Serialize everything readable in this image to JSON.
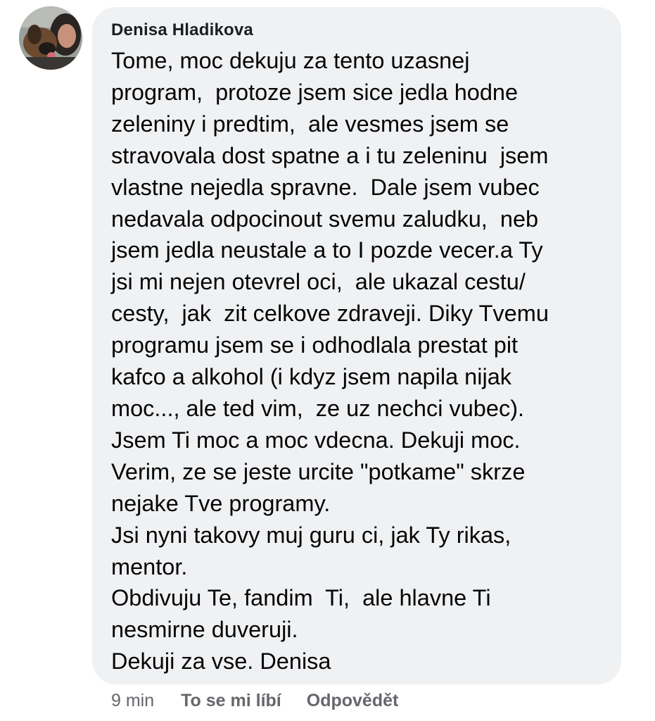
{
  "comment": {
    "author": "Denisa Hladikova",
    "lines": [
      "Tome, moc dekuju za tento uzasnej",
      "program,  protoze jsem sice jedla hodne",
      "zeleniny i predtim,  ale vesmes jsem se",
      "stravovala dost spatne a i tu zeleninu  jsem",
      "vlastne nejedla spravne.  Dale jsem vubec",
      "nedavala odpocinout svemu zaludku,  neb",
      "jsem jedla neustale a to I pozde vecer.a Ty",
      "jsi mi nejen otevrel oci,  ale ukazal cestu/",
      "cesty,  jak  zit celkove zdraveji. Diky Tvemu",
      "programu jsem se i odhodlala prestat pit",
      "kafco a alkohol (i kdyz jsem napila nijak",
      "moc..., ale ted vim,  ze uz nechci vubec).",
      "Jsem Ti moc a moc vdecna. Dekuji moc.",
      "Verim, ze se jeste urcite \"potkame\" skrze",
      "nejake Tve programy.",
      "Jsi nyni takovy muj guru ci, jak Ty rikas,",
      "mentor.",
      "Obdivuju Te, fandim  Ti,  ale hlavne Ti",
      "nesmirne duveruji.",
      "Dekuji za vse. Denisa"
    ],
    "timestamp": "9 min",
    "like_label": "To se mi líbí",
    "reply_label": "Odpovědět"
  },
  "colors": {
    "bubble": "#f0f1f3",
    "meta_text": "#65676b",
    "body_text": "#050505"
  }
}
